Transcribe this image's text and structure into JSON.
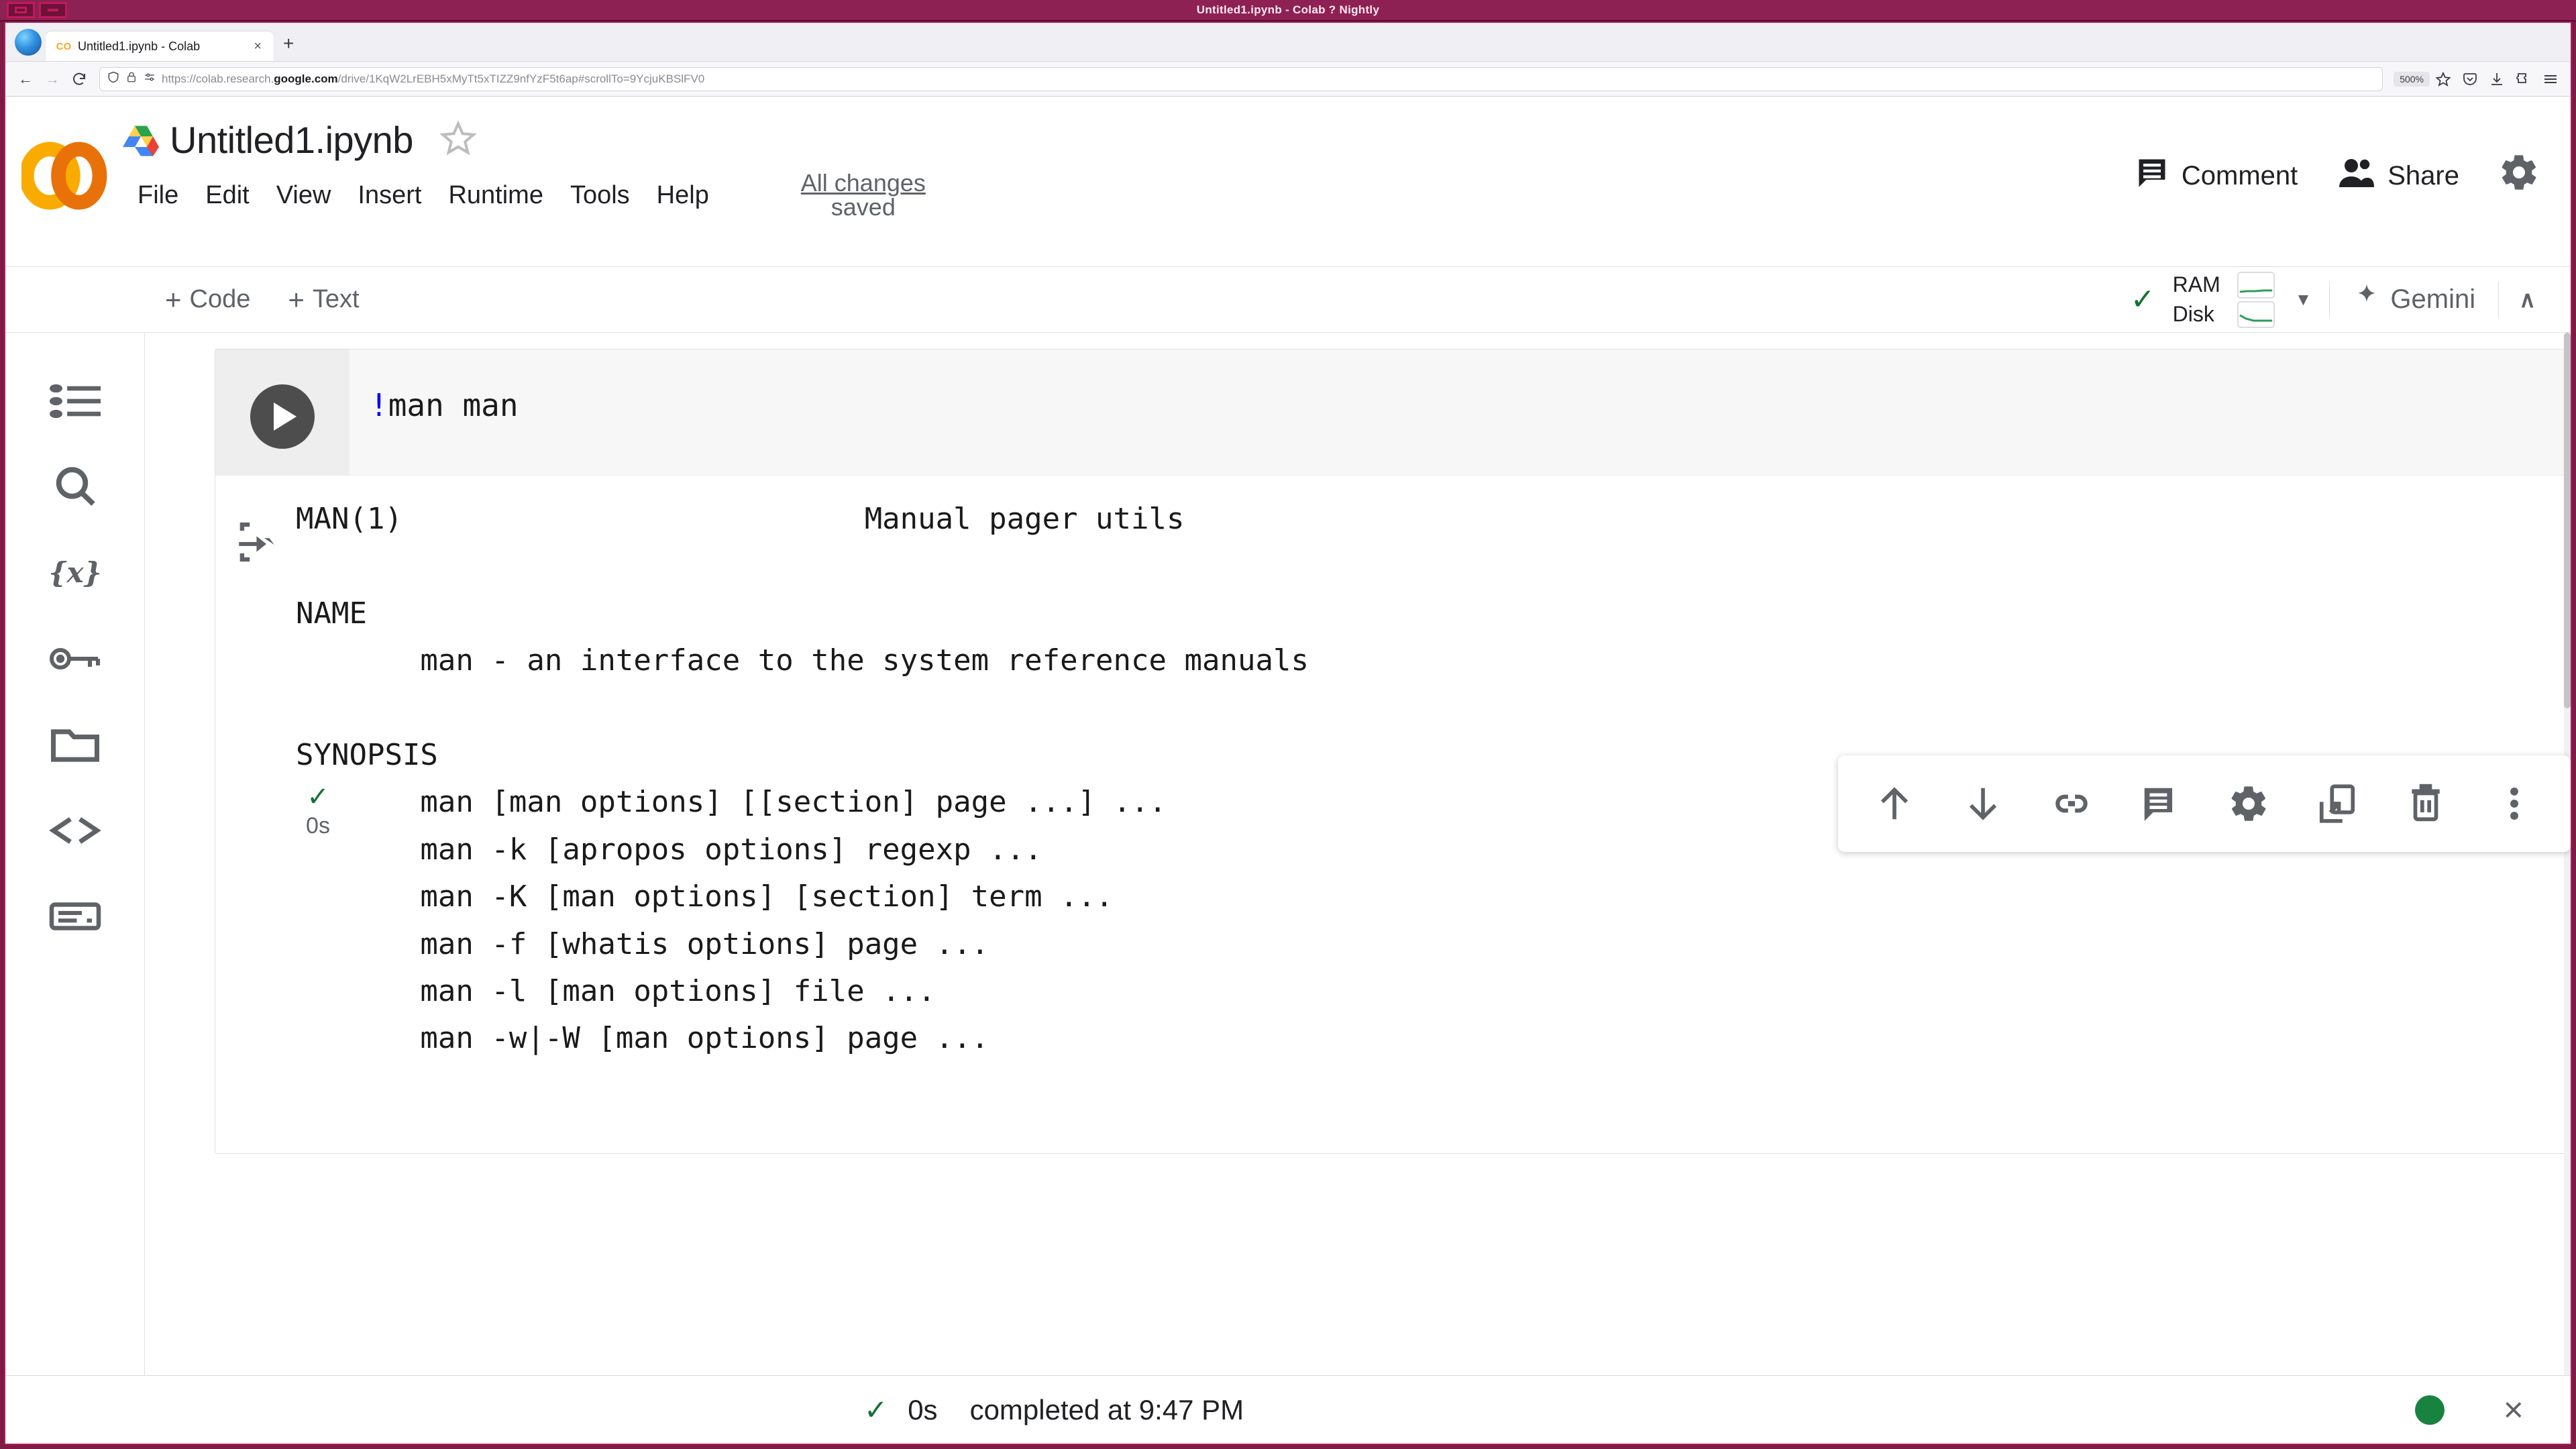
{
  "window": {
    "title": "Untitled1.ipynb - Colab ? Nightly",
    "buttons": {
      "minimize": "minimize",
      "restore": "restore"
    }
  },
  "browser": {
    "tab": {
      "favicon": "CO",
      "title": "Untitled1.ipynb - Colab",
      "close_label": "×"
    },
    "new_tab_label": "+",
    "nav": {
      "back": "←",
      "forward": "→",
      "reload": "⟳",
      "shield_icon": "shield-icon",
      "lock_icon": "lock-icon",
      "permissions_icon": "permissions-icon"
    },
    "url": {
      "scheme": "https://colab.research.",
      "domain": "google.com",
      "path": "/drive/1KqW2LrEBH5xMyTt5xTIZZ9nfYzF5t6ap#scrollTo=9YcjuKBSlFV0",
      "full": "https://colab.research.google.com/drive/1KqW2LrEBH5xMyTt5xTIZZ9nfYzF5t6ap#scrollTo=9YcjuKBSlFV0"
    },
    "zoom_level": "500%",
    "bookmark_icon": "star-icon",
    "toolbar_right": [
      "pocket-icon",
      "downloads-icon",
      "extensions-icon",
      "menu-icon"
    ]
  },
  "colab": {
    "logo": "colab-logo",
    "drive_icon": "google-drive-icon",
    "notebook_name": "Untitled1.ipynb",
    "star_icon": "star-outline-icon",
    "menus": [
      "File",
      "Edit",
      "View",
      "Insert",
      "Runtime",
      "Tools",
      "Help"
    ],
    "save_status_line1": "All changes",
    "save_status_line2": "saved",
    "header_actions": {
      "comment": "Comment",
      "share": "Share",
      "settings_icon": "gear-icon"
    },
    "toolbar": {
      "add_code": "Code",
      "add_text": "Text",
      "plus": "+",
      "connected_check": "✓",
      "ram_label": "RAM",
      "disk_label": "Disk",
      "resource_caret": "▼",
      "gemini_label": "Gemini",
      "gemini_icon": "sparkle-icon",
      "collapse_caret": "∧"
    },
    "sidebar": [
      {
        "name": "table-of-contents",
        "label": "Table of contents"
      },
      {
        "name": "search",
        "label": "Find and replace"
      },
      {
        "name": "variables",
        "label": "Variables"
      },
      {
        "name": "secrets",
        "label": "Secrets"
      },
      {
        "name": "files",
        "label": "Files"
      },
      {
        "name": "code-snippets",
        "label": "Code snippets"
      },
      {
        "name": "terminal",
        "label": "Terminal"
      }
    ],
    "cell": {
      "exec_check": "✓",
      "exec_time": "0s",
      "run_button": "run-cell-button",
      "code_prefix": "!",
      "code_text": "man man",
      "output_toggle_icon": "output-scroll-icon",
      "output": "MAN(1)                          Manual pager utils\n\nNAME\n       man - an interface to the system reference manuals\n\nSYNOPSIS\n       man [man options] [[section] page ...] ...\n       man -k [apropos options] regexp ...\n       man -K [man options] [section] term ...\n       man -f [whatis options] page ...\n       man -l [man options] file ...\n       man -w|-W [man options] page ..."
    },
    "cell_toolbar": [
      {
        "name": "move-cell-up-icon",
        "label": "Move cell up"
      },
      {
        "name": "move-cell-down-icon",
        "label": "Move cell down"
      },
      {
        "name": "link-to-cell-icon",
        "label": "Link to cell"
      },
      {
        "name": "add-comment-icon",
        "label": "Add comment"
      },
      {
        "name": "cell-settings-icon",
        "label": "Cell settings"
      },
      {
        "name": "mirror-cell-icon",
        "label": "Mirror cell in tab"
      },
      {
        "name": "delete-cell-icon",
        "label": "Delete cell"
      },
      {
        "name": "more-options-icon",
        "label": "More cell actions"
      }
    ],
    "status_bar": {
      "check": "✓",
      "duration": "0s",
      "message": "completed at 9:47 PM",
      "connection_dot": "connected",
      "close": "×"
    }
  },
  "colors": {
    "window_chrome": "#7d1b44",
    "window_chrome_accent": "#c2185b",
    "success_green": "#137333",
    "connected_green": "#18833f",
    "colab_orange": "#f9ab00",
    "code_magic_blue": "#0000ff",
    "text_primary": "#202124",
    "text_secondary": "#5f6368"
  }
}
